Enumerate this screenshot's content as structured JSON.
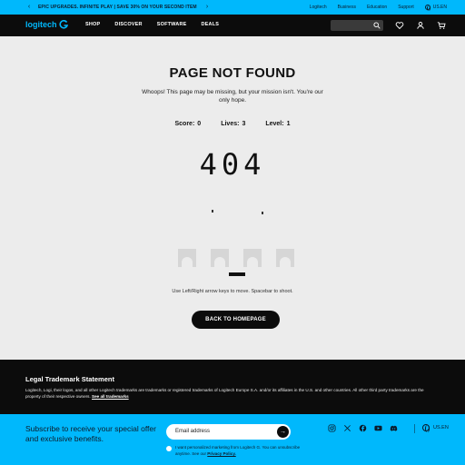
{
  "promo": {
    "message": "EPIC UPGRADES. INFINITE PLAY | SAVE 30% ON YOUR SECOND ITEM",
    "links": [
      "Logitech",
      "Business",
      "Education",
      "Support"
    ],
    "locale": "US.EN"
  },
  "nav": {
    "brand": "logitech",
    "items": [
      "SHOP",
      "DISCOVER",
      "SOFTWARE",
      "DEALS"
    ]
  },
  "main": {
    "title": "PAGE NOT FOUND",
    "subtitle": "Whoops! This page may be missing, but your mission isn't. You're our only hope.",
    "score_label": "Score:",
    "score": "0",
    "lives_label": "Lives:",
    "lives": "3",
    "level_label": "Level:",
    "level": "1",
    "code": "404",
    "hint": "Use Left/Right arrow keys to move. Spacebar to shoot.",
    "button": "BACK TO HOMEPAGE"
  },
  "legal": {
    "title": "Legal Trademark Statement",
    "text": "Logitech, Logi, their logos, and all other Logitech trademarks are trademarks or registered trademarks of Logitech Europe S.A. and/or its affiliates in the U.S. and other countries. All other third party trademarks are the property of their respective owners.",
    "link": "See all trademarks"
  },
  "footer": {
    "subscribe": "Subscribe to receive your special offer and exclusive benefits.",
    "email_placeholder": "Email address",
    "consent": "I want personalized marketing from Logitech G. You can unsubscribe anytime. See our",
    "privacy": "Privacy Policy.",
    "locale": "US.EN"
  },
  "colors": {
    "accent": "#00b8fc",
    "dark": "#0c0c0c",
    "background": "#ececec"
  },
  "icons": [
    "chevron-left-icon",
    "chevron-right-icon",
    "globe-icon",
    "logitech-g-icon",
    "search-icon",
    "heart-icon",
    "user-icon",
    "cart-icon",
    "arrow-right-icon",
    "instagram-icon",
    "x-icon",
    "facebook-icon",
    "youtube-icon",
    "discord-icon"
  ]
}
